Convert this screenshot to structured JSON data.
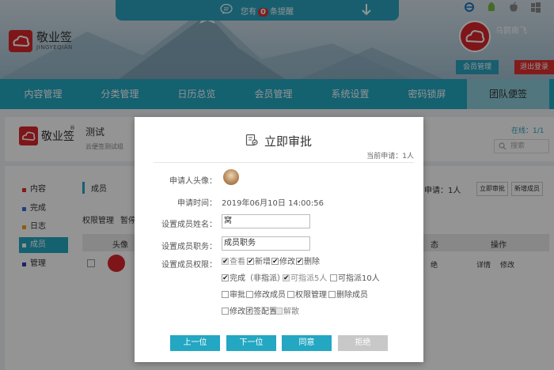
{
  "header": {
    "notice_prefix": "您有",
    "notice_count": "0",
    "notice_suffix": "条提醒",
    "logo_text": "敬业签",
    "logo_sub": "JINGYEQIAN",
    "user_name": "乌鹊南飞",
    "member_button": "会员管理",
    "logout_button": "退出登录",
    "top_icons": [
      "ie-icon",
      "android-icon",
      "apple-icon",
      "windows-icon"
    ]
  },
  "nav": {
    "items": [
      "内容管理",
      "分类管理",
      "日历总览",
      "会员管理",
      "系统设置",
      "密码锁屏",
      "团队便签"
    ],
    "active_index": 6
  },
  "sub": {
    "logo_text": "敬业签",
    "reg_mark": "®",
    "team_name": "测试",
    "team_desc": "云便签测试组",
    "online": "在线：1/1",
    "search_placeholder": "搜索"
  },
  "sidebar": {
    "items": [
      {
        "label": "内容",
        "color": "#e02f2f"
      },
      {
        "label": "完成",
        "color": "#3a6fd8"
      },
      {
        "label": "日志",
        "color": "#f0a020"
      },
      {
        "label": "成员",
        "color": "#ffffff"
      },
      {
        "label": "管理",
        "color": "#3a3ab0"
      }
    ],
    "active_index": 3
  },
  "panel": {
    "title": "成员",
    "tabs": [
      "权限管理",
      "暂停"
    ],
    "apply_info": "申请：1人",
    "btn_approve": "立即审批",
    "btn_add": "新增成员",
    "col_avatar": "头像",
    "col_status": "态",
    "col_ops": "操作",
    "row_status": "绝",
    "row_op_detail": "详情",
    "row_op_edit": "修改"
  },
  "modal": {
    "title": "立即审批",
    "current_apply": "当前申请：1人",
    "applicant_avatar_label": "申请人头像：",
    "apply_time_label": "申请时间：",
    "apply_time_value": "2019年06月10日 14:00:56",
    "name_label": "设置成员姓名：",
    "name_value": "窝",
    "role_label": "设置成员职务：",
    "role_value": "成员职务",
    "perm_label": "设置成员权限：",
    "permissions": {
      "view": {
        "label": "查看",
        "checked": true,
        "disabled": true
      },
      "add": {
        "label": "新增",
        "checked": true,
        "disabled": false
      },
      "edit": {
        "label": "修改",
        "checked": true,
        "disabled": false
      },
      "delete": {
        "label": "删除",
        "checked": true,
        "disabled": false
      },
      "complete": {
        "label": "完成（非指派）",
        "checked": true,
        "disabled": false
      },
      "assign5": {
        "label": "可指派5人",
        "checked": true,
        "disabled": true
      },
      "assign10": {
        "label": "可指派10人",
        "checked": false,
        "disabled": false
      },
      "approve": {
        "label": "审批",
        "checked": false,
        "disabled": false
      },
      "edit_member": {
        "label": "修改成员",
        "checked": false,
        "disabled": false
      },
      "perm_manage": {
        "label": "权限管理",
        "checked": false,
        "disabled": false
      },
      "delete_member": {
        "label": "删除成员",
        "checked": false,
        "disabled": false
      },
      "team_config": {
        "label": "修改团签配置",
        "checked": false,
        "disabled": false
      },
      "dissolve": {
        "label": "解散",
        "checked": false,
        "disabled": true
      }
    },
    "btn_prev": "上一位",
    "btn_next": "下一位",
    "btn_agree": "同意",
    "btn_reject": "拒绝"
  },
  "colors": {
    "accent": "#23a7c2",
    "brand_red": "#d9262b",
    "danger": "#e02f2f"
  }
}
